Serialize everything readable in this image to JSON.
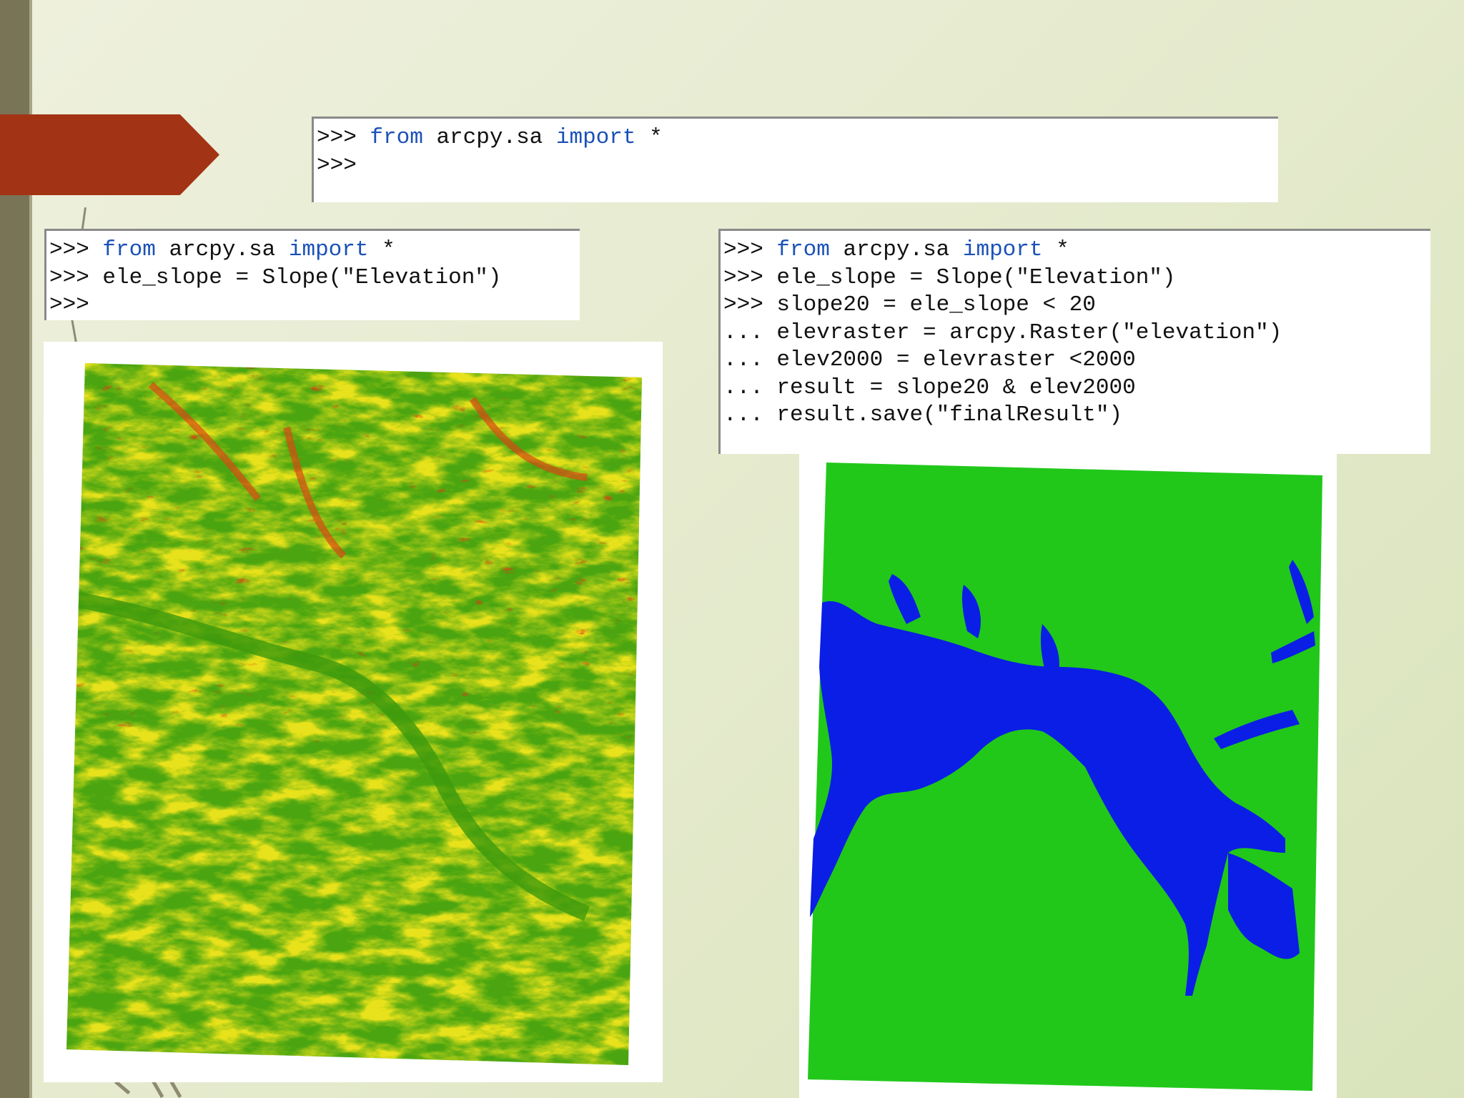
{
  "colors": {
    "keyword": "#1b51b8",
    "code_text": "#111111",
    "accent_arrow": "#a33315",
    "sidebar": "#7a7457",
    "slope_low": "#4aa511",
    "slope_mid": "#e8e21a",
    "slope_high": "#e23a10",
    "result_true": "#21c81a",
    "result_false": "#0a1ee6"
  },
  "console_top": {
    "lines": [
      [
        {
          "t": ">>> "
        },
        {
          "t": "from",
          "kw": true
        },
        {
          "t": " arcpy.sa "
        },
        {
          "t": "import",
          "kw": true
        },
        {
          "t": " *"
        }
      ],
      [
        {
          "t": ">>>"
        }
      ]
    ]
  },
  "console_left": {
    "lines": [
      [
        {
          "t": ">>> "
        },
        {
          "t": "from",
          "kw": true
        },
        {
          "t": " arcpy.sa "
        },
        {
          "t": "import",
          "kw": true
        },
        {
          "t": " *"
        }
      ],
      [
        {
          "t": ">>> ele_slope = Slope(\"Elevation\")"
        }
      ],
      [
        {
          "t": ">>>"
        }
      ]
    ]
  },
  "console_right": {
    "lines": [
      [
        {
          "t": ">>> "
        },
        {
          "t": "from",
          "kw": true
        },
        {
          "t": " arcpy.sa "
        },
        {
          "t": "import",
          "kw": true
        },
        {
          "t": " *"
        }
      ],
      [
        {
          "t": ">>> ele_slope = Slope(\"Elevation\")"
        }
      ],
      [
        {
          "t": ">>> slope20 = ele_slope < 20"
        }
      ],
      [
        {
          "t": "... elevraster = arcpy.Raster(\"elevation\")"
        }
      ],
      [
        {
          "t": "... elev2000 = elevraster <2000"
        }
      ],
      [
        {
          "t": "... result = slope20 & elev2000"
        }
      ],
      [
        {
          "t": "... result.save(\"finalResult\")"
        }
      ]
    ]
  }
}
